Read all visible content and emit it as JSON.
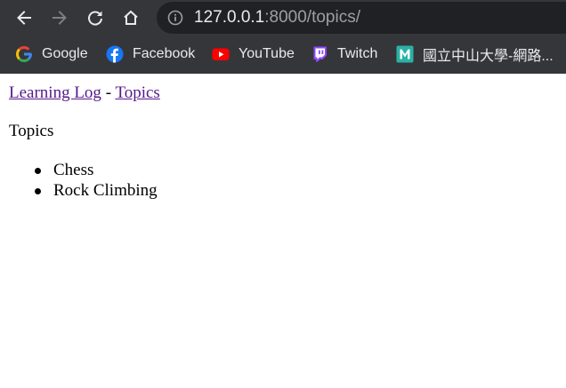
{
  "browser": {
    "url_host": "127.0.0.1",
    "url_rest": ":8000/topics/",
    "icons": {
      "back": "back-arrow-icon",
      "forward": "forward-arrow-icon",
      "reload": "reload-icon",
      "home": "home-icon",
      "info": "info-icon"
    },
    "colors": {
      "toolbar_bg": "#35363a",
      "omnibox_bg": "#202124",
      "text": "#e8eaed"
    },
    "bookmarks": [
      {
        "label": "Google",
        "icon": "google-icon"
      },
      {
        "label": "Facebook",
        "icon": "facebook-icon"
      },
      {
        "label": "YouTube",
        "icon": "youtube-icon"
      },
      {
        "label": "Twitch",
        "icon": "twitch-icon"
      },
      {
        "label": "國立中山大學-網路...",
        "icon": "m-logo-icon"
      }
    ]
  },
  "page": {
    "nav": {
      "home_link": "Learning Log",
      "separator": "-",
      "topics_link": "Topics"
    },
    "heading": "Topics",
    "topics": [
      "Chess",
      "Rock Climbing"
    ],
    "link_color": "#551a8b"
  }
}
